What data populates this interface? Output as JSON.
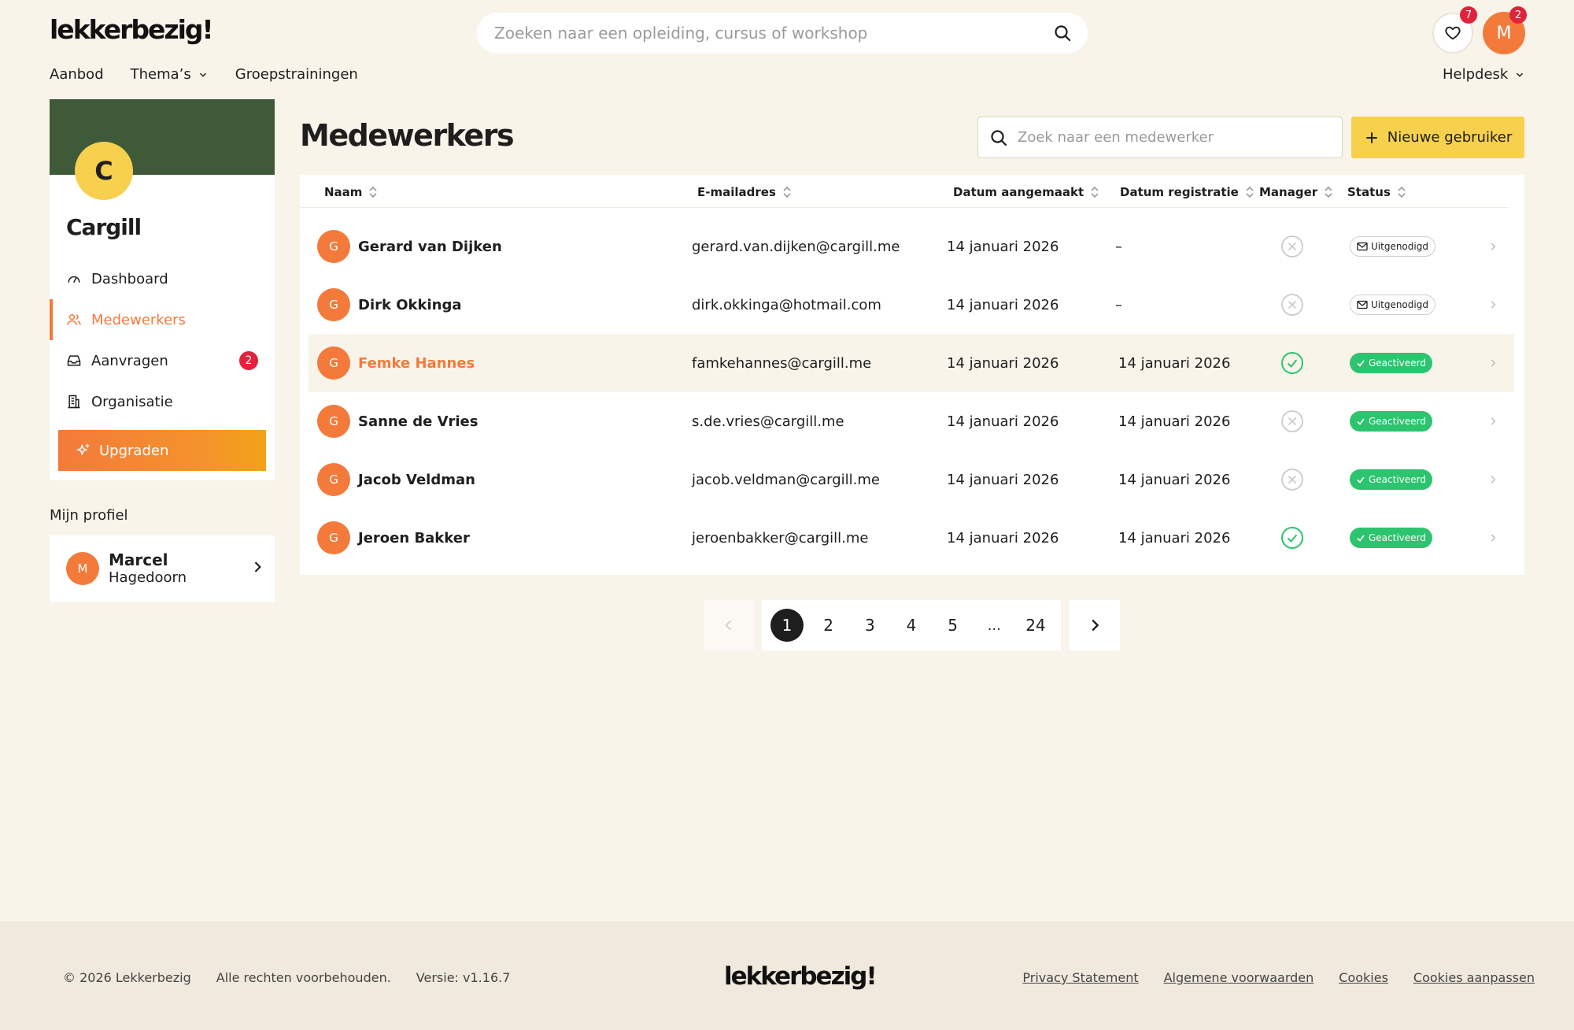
{
  "brand": {
    "logo": "lekkerbezig!"
  },
  "header": {
    "search_placeholder": "Zoeken naar een opleiding, cursus of workshop",
    "favorites_count": "7",
    "user_initial": "M",
    "user_notifications": "2"
  },
  "topnav": {
    "items": [
      "Aanbod",
      "Thema’s",
      "Groepstrainingen"
    ],
    "helpdesk": "Helpdesk"
  },
  "sidebar": {
    "org_initial": "C",
    "org_name": "Cargill",
    "items": [
      {
        "label": "Dashboard",
        "icon": "gauge-icon"
      },
      {
        "label": "Medewerkers",
        "icon": "users-icon",
        "active": true
      },
      {
        "label": "Aanvragen",
        "icon": "inbox-icon",
        "badge": "2"
      },
      {
        "label": "Organisatie",
        "icon": "building-icon"
      }
    ],
    "upgrade_label": "Upgraden",
    "profile_heading": "Mijn profiel",
    "profile": {
      "initial": "M",
      "first": "Marcel",
      "last": "Hagedoorn"
    }
  },
  "main": {
    "title": "Medewerkers",
    "search_placeholder": "Zoek naar een medewerker",
    "new_user_label": "Nieuwe gebruiker",
    "columns": [
      "Naam",
      "E-mailadres",
      "Datum aangemaakt",
      "Datum registratie",
      "Manager",
      "Status"
    ],
    "rows": [
      {
        "initial": "G",
        "name": "Gerard van Dijken",
        "email": "gerard.van.dijken@cargill.me",
        "created": "14 januari 2026",
        "registered": "–",
        "manager": false,
        "status": "Uitgenodigd",
        "status_type": "invited"
      },
      {
        "initial": "G",
        "name": "Dirk Okkinga",
        "email": "dirk.okkinga@hotmail.com",
        "created": "14 januari 2026",
        "registered": "–",
        "manager": false,
        "status": "Uitgenodigd",
        "status_type": "invited"
      },
      {
        "initial": "G",
        "name": "Femke Hannes",
        "email": "famkehannes@cargill.me",
        "created": "14 januari 2026",
        "registered": "14 januari 2026",
        "manager": true,
        "status": "Geactiveerd",
        "status_type": "active",
        "highlight": true
      },
      {
        "initial": "G",
        "name": "Sanne de Vries",
        "email": "s.de.vries@cargill.me",
        "created": "14 januari 2026",
        "registered": "14 januari 2026",
        "manager": false,
        "status": "Geactiveerd",
        "status_type": "active"
      },
      {
        "initial": "G",
        "name": "Jacob Veldman",
        "email": "jacob.veldman@cargill.me",
        "created": "14 januari 2026",
        "registered": "14 januari 2026",
        "manager": false,
        "status": "Geactiveerd",
        "status_type": "active"
      },
      {
        "initial": "G",
        "name": "Jeroen Bakker",
        "email": "jeroenbakker@cargill.me",
        "created": "14 januari 2026",
        "registered": "14 januari 2026",
        "manager": true,
        "status": "Geactiveerd",
        "status_type": "active"
      }
    ]
  },
  "pagination": {
    "pages": [
      "1",
      "2",
      "3",
      "4",
      "5"
    ],
    "ellipsis": "...",
    "last": "24",
    "current": "1"
  },
  "footer": {
    "copyright": "© 2026 Lekkerbezig",
    "rights": "Alle rechten voorbehouden.",
    "version": "Versie: v1.16.7",
    "logo": "lekkerbezig!",
    "links": [
      "Privacy Statement",
      "Algemene voorwaarden",
      "Cookies",
      "Cookies aanpassen"
    ]
  },
  "colors": {
    "background": "#F8F4EA",
    "accent_orange": "#F47A3B",
    "accent_yellow": "#F7D04E",
    "banner_green": "#3E5A38",
    "status_green": "#2CC46E",
    "badge_red": "#E0223A"
  }
}
